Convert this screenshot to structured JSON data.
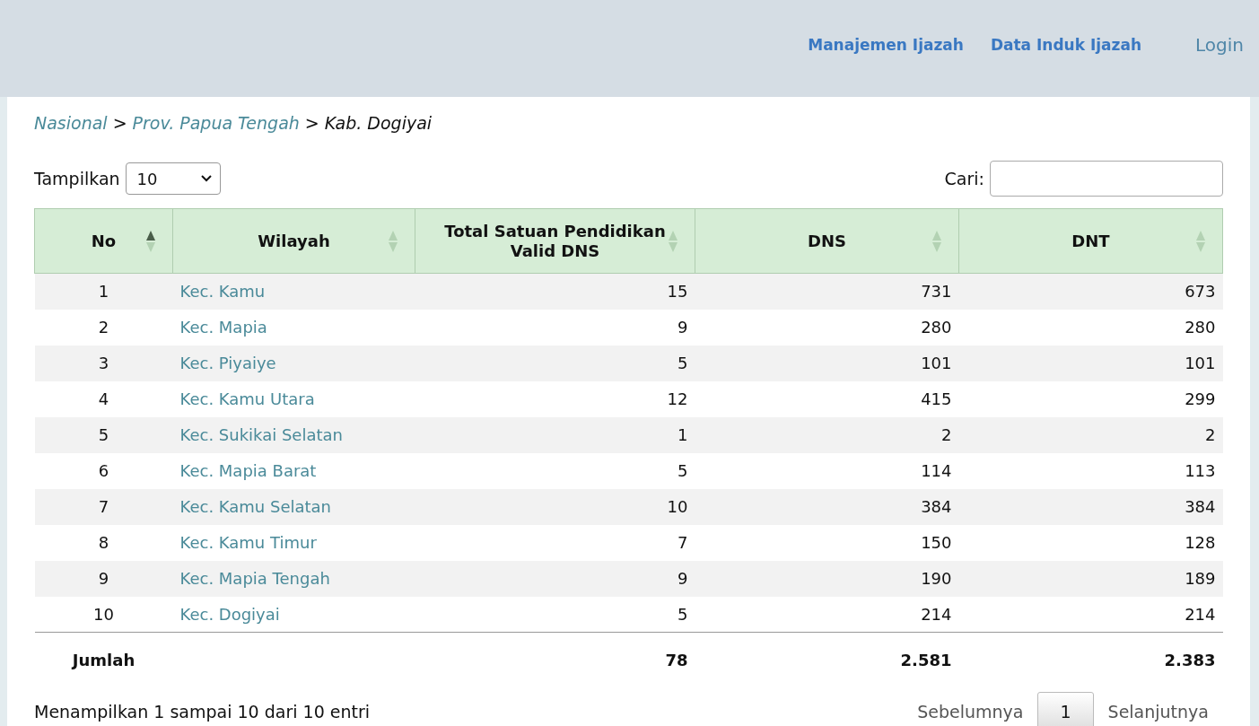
{
  "nav": {
    "links": [
      "Manajemen Ijazah",
      "Data Induk Ijazah"
    ],
    "login": "Login"
  },
  "breadcrumb": {
    "links": [
      "Nasional",
      "Prov. Papua Tengah"
    ],
    "separator": ">",
    "current": "Kab. Dogiyai"
  },
  "length_control": {
    "label": "Tampilkan",
    "value": "10"
  },
  "search": {
    "label": "Cari:"
  },
  "table": {
    "columns": [
      {
        "title": "No",
        "sorted": true
      },
      {
        "title": "Wilayah",
        "sorted": false
      },
      {
        "title": "Total Satuan Pendidikan Valid DNS",
        "sorted": false
      },
      {
        "title": "DNS",
        "sorted": false
      },
      {
        "title": "DNT",
        "sorted": false
      }
    ],
    "rows": [
      [
        "1",
        "Kec. Kamu",
        "15",
        "731",
        "673"
      ],
      [
        "2",
        "Kec. Mapia",
        "9",
        "280",
        "280"
      ],
      [
        "3",
        "Kec. Piyaiye",
        "5",
        "101",
        "101"
      ],
      [
        "4",
        "Kec. Kamu Utara",
        "12",
        "415",
        "299"
      ],
      [
        "5",
        "Kec. Sukikai Selatan",
        "1",
        "2",
        "2"
      ],
      [
        "6",
        "Kec. Mapia Barat",
        "5",
        "114",
        "113"
      ],
      [
        "7",
        "Kec. Kamu Selatan",
        "10",
        "384",
        "384"
      ],
      [
        "8",
        "Kec. Kamu Timur",
        "7",
        "150",
        "128"
      ],
      [
        "9",
        "Kec. Mapia Tengah",
        "9",
        "190",
        "189"
      ],
      [
        "10",
        "Kec. Dogiyai",
        "5",
        "214",
        "214"
      ]
    ],
    "footer": {
      "label": "Jumlah",
      "totals": [
        "78",
        "2.581",
        "2.383"
      ]
    }
  },
  "info": "Menampilkan 1 sampai 10 dari 10 entri",
  "pagination": {
    "previous": "Sebelumnya",
    "pages": [
      {
        "label": "1",
        "selected": true
      }
    ],
    "next": "Selanjutnya"
  }
}
